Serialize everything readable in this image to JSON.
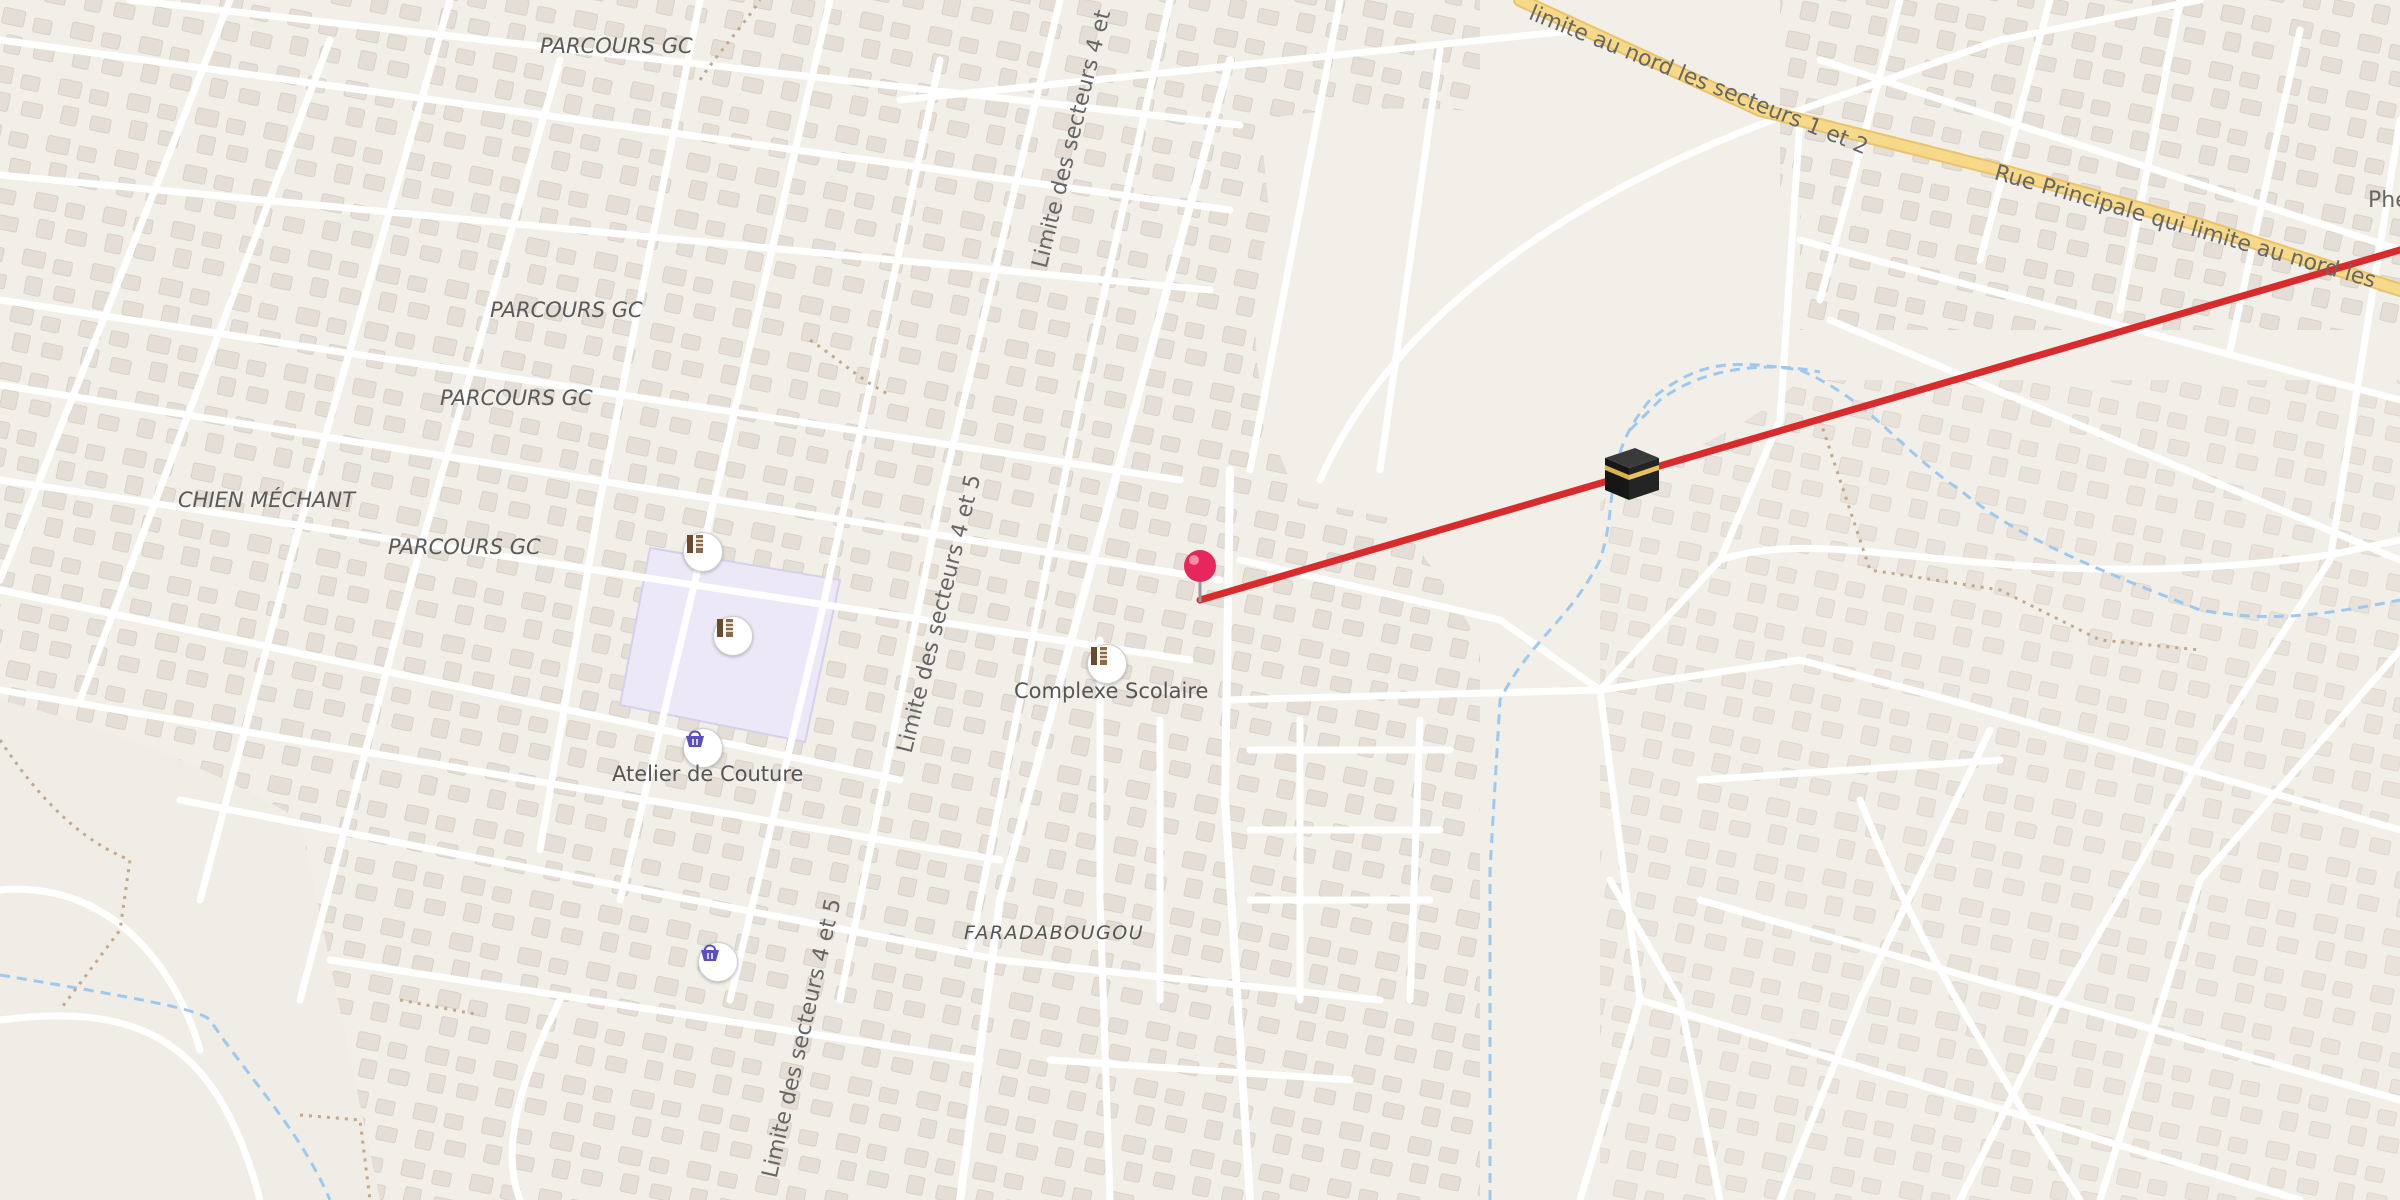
{
  "map": {
    "place_labels": [
      "PARCOURS GC",
      "PARCOURS GC",
      "PARCOURS GC",
      "CHIEN MÉCHANT",
      "PARCOURS GC"
    ],
    "road_labels": [
      "Limite des secteurs 4 et",
      "Limite des secteurs 4 et 5",
      "Limite des secteurs 4 et 5",
      "limite au nord les secteurs 1 et 2",
      "Rue Principale qui limite au nord les",
      "Phe"
    ],
    "area_label": "FARADABOUGOU",
    "pois": [
      {
        "label": "Complexe Scolaire",
        "icon": "school-icon"
      },
      {
        "label": "Atelier de Couture",
        "icon": "shop-basket-icon"
      }
    ],
    "unlabeled_icons": [
      "school-icon",
      "school-icon",
      "shop-basket-icon"
    ],
    "markers": {
      "location_pin": "location-pin-icon",
      "qibla_target": "kaaba-icon"
    },
    "colors": {
      "background": "#f2efe9",
      "road": "#ffffff",
      "main_road": "#f7d98a",
      "building": "#e0d9d0",
      "school_area": "#ece8f7",
      "qibla_line": "#d92b2b",
      "stream": "#9ec9ef",
      "pin": "#e8265e",
      "path": "#c2a98a"
    }
  }
}
